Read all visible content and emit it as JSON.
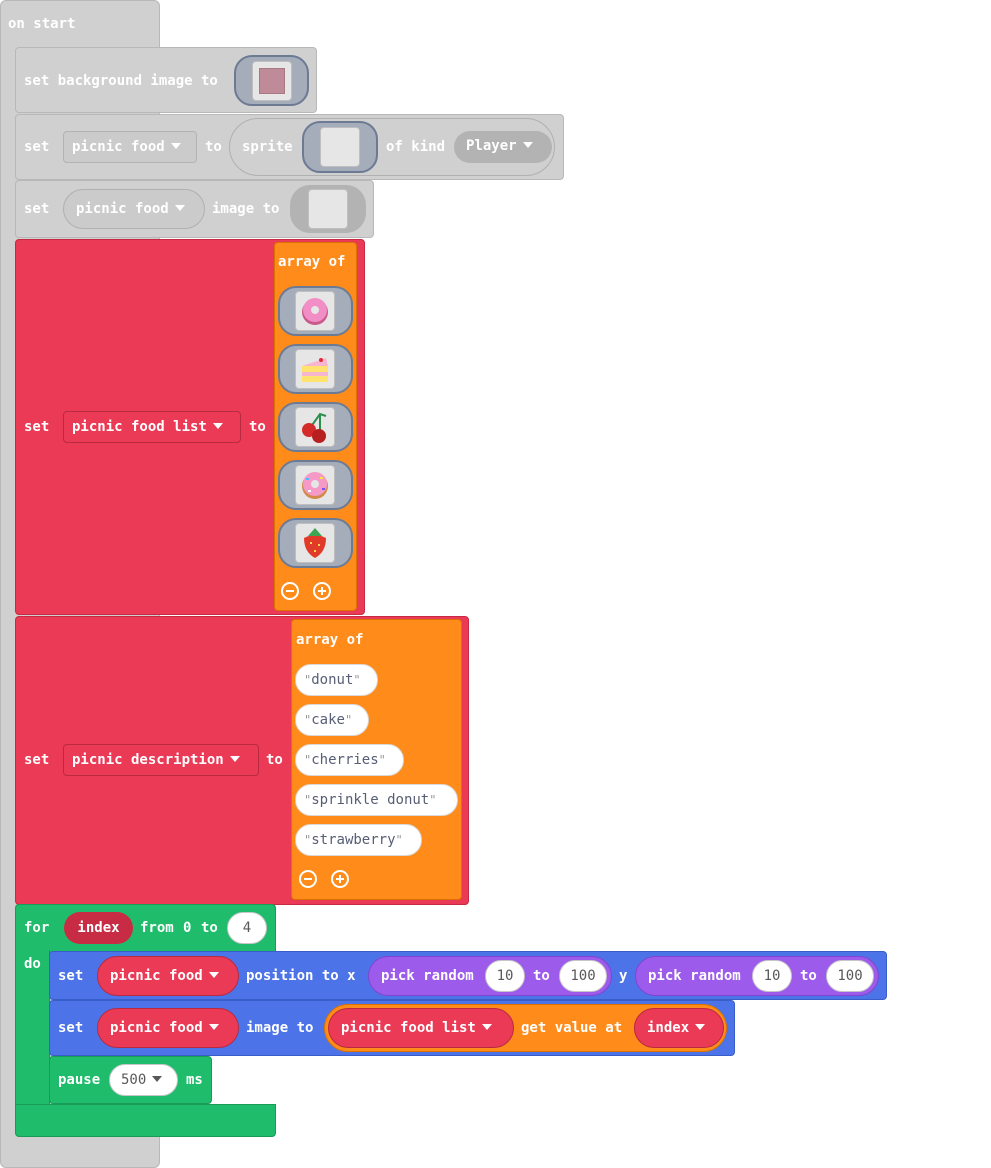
{
  "on_start": {
    "label": "on start"
  },
  "set_background": {
    "label": "set background image to"
  },
  "set_sprite": {
    "set": "set",
    "variable": "picnic food",
    "to": "to",
    "sprite_label": "sprite",
    "of_kind": "of kind",
    "kind": "Player"
  },
  "set_image": {
    "set": "set",
    "variable": "picnic food",
    "image_to": "image to"
  },
  "food_list": {
    "set": "set",
    "variable": "picnic food list",
    "to": "to",
    "array_of": "array of",
    "items": [
      "donut-image",
      "cake-image",
      "cherries-image",
      "sprinkle-donut-image",
      "strawberry-image"
    ]
  },
  "description": {
    "set": "set",
    "variable": "picnic description",
    "to": "to",
    "array_of": "array of",
    "items": [
      "donut",
      "cake",
      "cherries",
      "sprinkle donut",
      "strawberry"
    ]
  },
  "for_loop": {
    "for": "for",
    "var": "index",
    "from": "from",
    "start": "0",
    "to": "to",
    "end": "4",
    "do": "do"
  },
  "set_position": {
    "set": "set",
    "variable": "picnic food",
    "position_to_x": "position to x",
    "pick_random": "pick random",
    "x_min": "10",
    "to": "to",
    "x_max": "100",
    "y": "y",
    "y_min": "10",
    "y_max": "100"
  },
  "set_image_from_list": {
    "set": "set",
    "variable": "picnic food",
    "image_to": "image to",
    "list": "picnic food list",
    "get_value_at": "get value at",
    "index": "index"
  },
  "pause": {
    "label": "pause",
    "value": "500",
    "unit": "ms"
  },
  "colors": {
    "events": "#d0d0d0",
    "variables": "#ea3a56",
    "arrays": "#ff8c1a",
    "loops": "#1fbd6b",
    "sprites": "#4c74e8",
    "math": "#9c5bea"
  }
}
